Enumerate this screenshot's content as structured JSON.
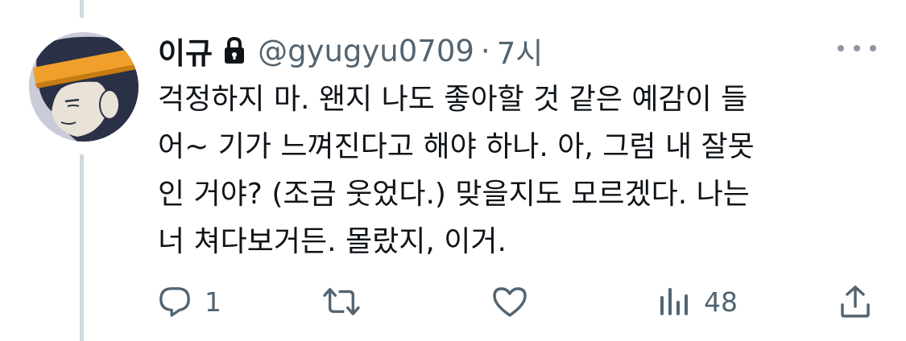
{
  "tweet": {
    "display_name": "이규",
    "handle": "@gyugyu0709",
    "separator": "·",
    "time": "7시",
    "protected_icon": "lock-icon",
    "more_icon": "more-horizontal-icon",
    "text_lines": [
      "걱정하지 마. 왠지 나도 좋아할 것 같은 예감이 들",
      "어~ 기가 느껴진다고 해야 하나. 아, 그럼 내 잘못",
      "인 거야? (조금 웃었다.) 맞을지도 모르겠다. 나는",
      "너 쳐다보거든. 몰랐지, 이거."
    ]
  },
  "actions": {
    "reply": {
      "icon": "reply-icon",
      "count": "1"
    },
    "retweet": {
      "icon": "retweet-icon",
      "count": ""
    },
    "like": {
      "icon": "heart-icon",
      "count": ""
    },
    "views": {
      "icon": "views-chart-icon",
      "count": "48"
    },
    "share": {
      "icon": "share-icon"
    }
  },
  "colors": {
    "text_primary": "#0f1419",
    "text_secondary": "#536471",
    "thread_line": "#cfd9de",
    "avatar_hair": "#2a3046",
    "avatar_headband": "#f0a02a"
  }
}
